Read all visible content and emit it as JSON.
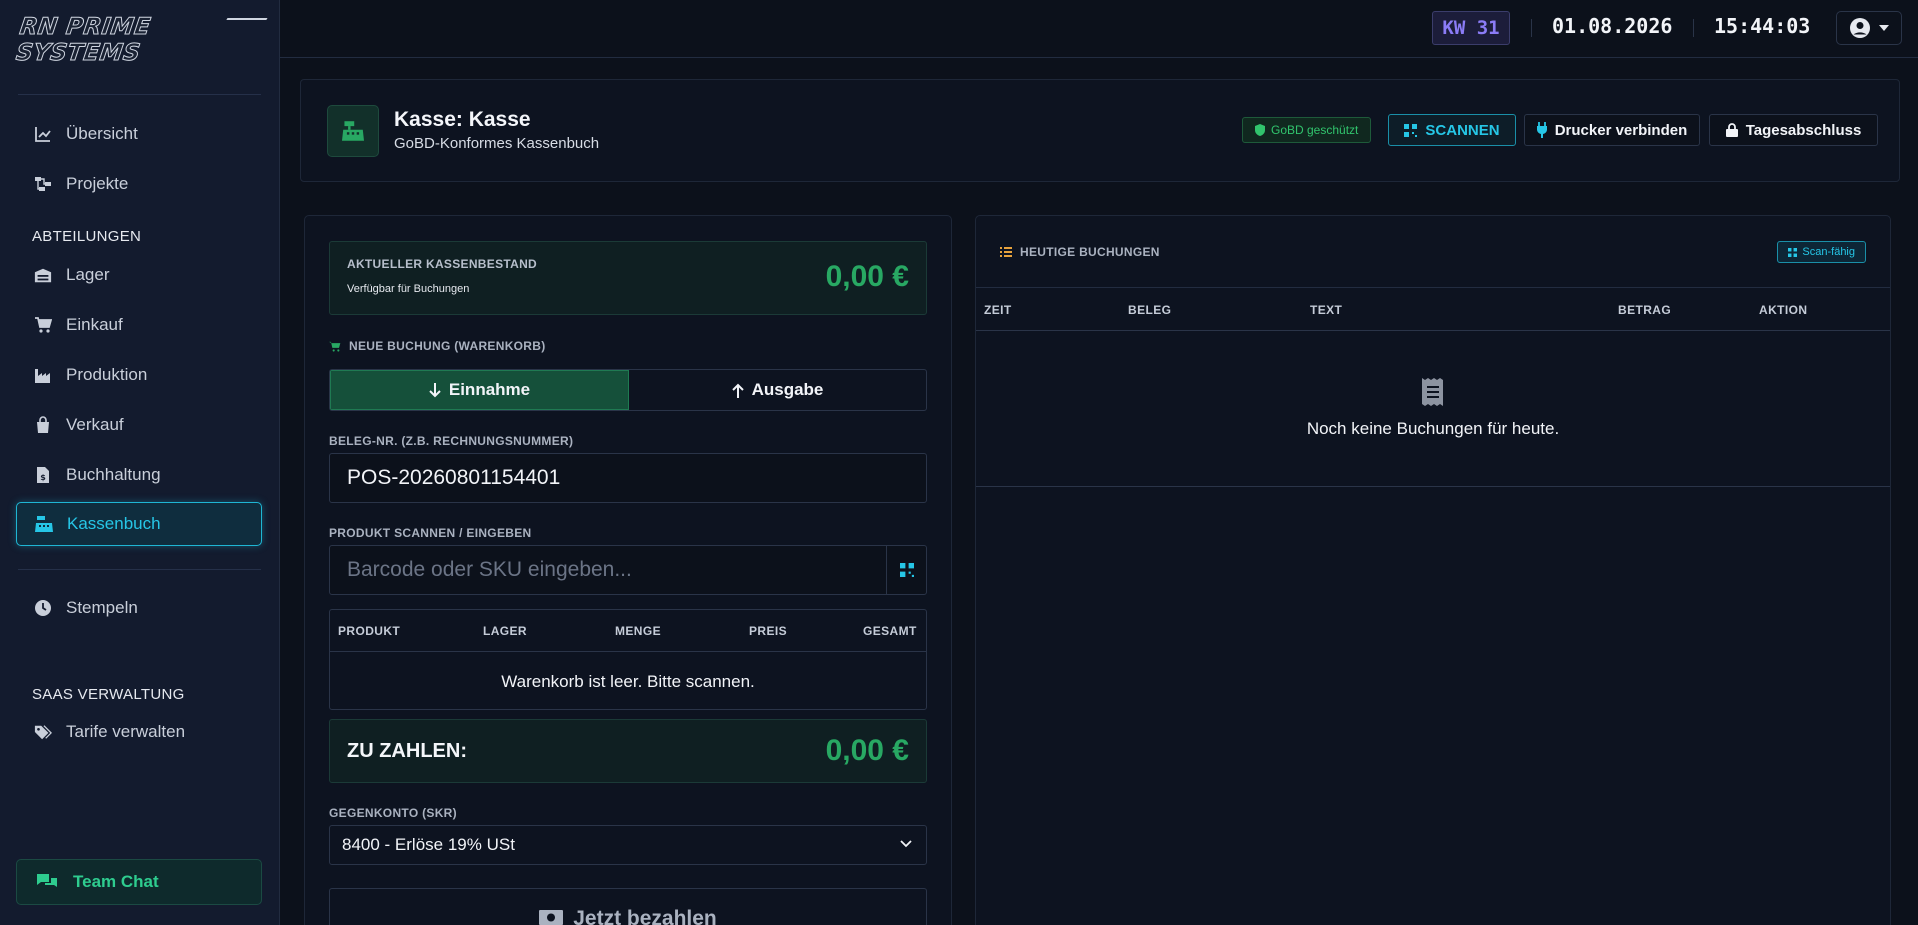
{
  "app": {
    "logo_text": "RN PRIME SYSTEMS"
  },
  "topbar": {
    "week": "KW 31",
    "date": "01.08.2026",
    "time": "15:44:03"
  },
  "sidebar": {
    "items_top": [
      {
        "label": "Übersicht",
        "icon": "chart-line-icon"
      },
      {
        "label": "Projekte",
        "icon": "project-diagram-icon"
      }
    ],
    "departments_heading": "ABTEILUNGEN",
    "departments": [
      {
        "label": "Lager",
        "icon": "warehouse-icon"
      },
      {
        "label": "Einkauf",
        "icon": "shopping-cart-icon"
      },
      {
        "label": "Produktion",
        "icon": "industry-icon"
      },
      {
        "label": "Verkauf",
        "icon": "shopping-bag-icon"
      },
      {
        "label": "Buchhaltung",
        "icon": "file-invoice-dollar-icon"
      },
      {
        "label": "Kassenbuch",
        "icon": "cash-register-icon",
        "active": true
      }
    ],
    "stempeln": "Stempeln",
    "saas_heading": "SAAS VERWALTUNG",
    "tarife": "Tarife verwalten",
    "team_chat": "Team Chat"
  },
  "header": {
    "title": "Kasse: Kasse",
    "subtitle": "GoBD-Konformes Kassenbuch",
    "gobd_badge": "GoBD geschützt",
    "scan_button": "SCANNEN",
    "printer_button": "Drucker verbinden",
    "close_button": "Tagesabschluss"
  },
  "register": {
    "balance_label": "AKTUELLER KASSENBESTAND",
    "balance_sub": "Verfügbar für Buchungen",
    "balance_value": "0,00 €",
    "new_booking_label": "NEUE BUCHUNG (WARENKORB)",
    "income_label": "Einnahme",
    "expense_label": "Ausgabe",
    "receipt_label": "BELEG-NR. (Z.B. RECHNUNGSNUMMER)",
    "receipt_value": "POS-20260801154401",
    "product_label": "PRODUKT SCANNEN / EINGEBEN",
    "product_placeholder": "Barcode oder SKU eingeben...",
    "cart_columns": [
      "PRODUKT",
      "LAGER",
      "MENGE",
      "PREIS",
      "GESAMT"
    ],
    "cart_empty": "Warenkorb ist leer. Bitte scannen.",
    "to_pay_label": "ZU ZAHLEN:",
    "to_pay_value": "0,00 €",
    "account_label": "GEGENKONTO (SKR)",
    "account_value": "8400 - Erlöse 19% USt",
    "pay_button": "Jetzt bezahlen"
  },
  "bookings": {
    "title": "HEUTIGE BUCHUNGEN",
    "scan_badge": "Scan-fähig",
    "columns": [
      "ZEIT",
      "BELEG",
      "TEXT",
      "BETRAG",
      "AKTION"
    ],
    "empty_text": "Noch keine Buchungen für heute."
  },
  "colors": {
    "accent_cyan": "#26c6e6",
    "accent_green": "#28a863",
    "kw_purple": "#8b7cf6",
    "background": "#0c111b"
  }
}
